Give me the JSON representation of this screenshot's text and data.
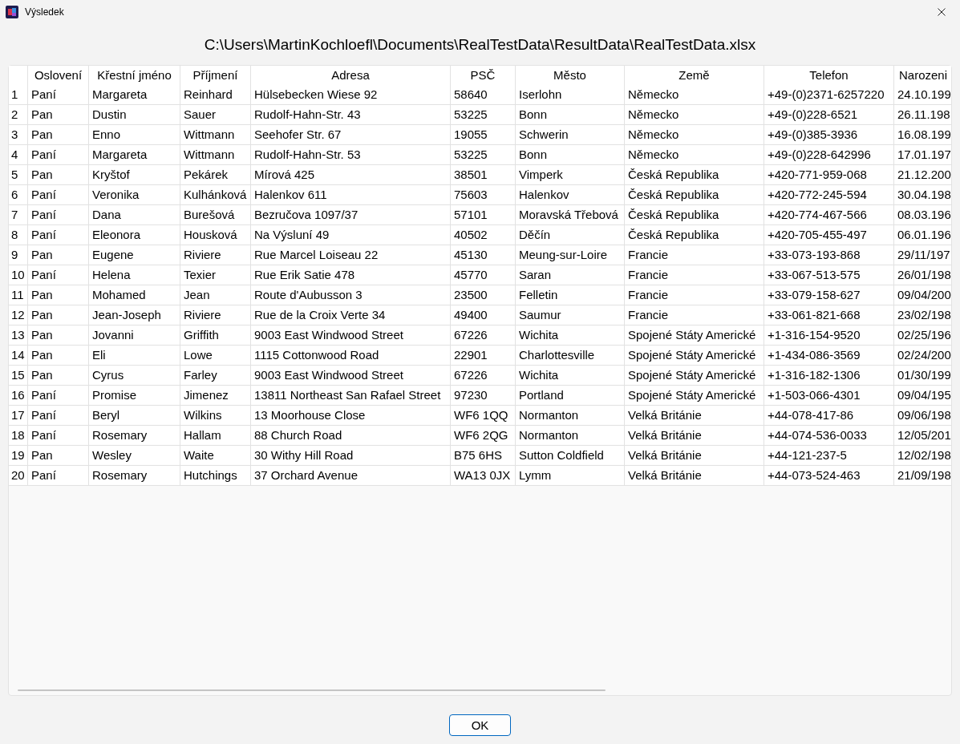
{
  "window": {
    "title": "Výsledek"
  },
  "path": "C:\\Users\\MartinKochloefl\\Documents\\RealTestData\\ResultData\\RealTestData.xlsx",
  "table": {
    "columns": [
      "Oslovení",
      "Křestní jméno",
      "Příjmení",
      "Adresa",
      "PSČ",
      "Město",
      "Země",
      "Telefon",
      "Narozeni"
    ],
    "rows": [
      {
        "number": "1",
        "cells": [
          "Paní",
          "Margareta",
          "Reinhard",
          "Hülsebecken Wiese 92",
          "58640",
          "Iserlohn",
          "Německo",
          "+49-(0)2371-6257220",
          "24.10.199"
        ]
      },
      {
        "number": "2",
        "cells": [
          "Pan",
          "Dustin",
          "Sauer",
          "Rudolf-Hahn-Str. 43",
          "53225",
          "Bonn",
          "Německo",
          "+49-(0)228-6521",
          "26.11.198"
        ]
      },
      {
        "number": "3",
        "cells": [
          "Pan",
          "Enno",
          "Wittmann",
          "Seehofer Str. 67",
          "19055",
          "Schwerin",
          "Německo",
          "+49-(0)385-3936",
          "16.08.199"
        ]
      },
      {
        "number": "4",
        "cells": [
          "Paní",
          "Margareta",
          "Wittmann",
          "Rudolf-Hahn-Str. 53",
          "53225",
          "Bonn",
          "Německo",
          "+49-(0)228-642996",
          "17.01.197"
        ]
      },
      {
        "number": "5",
        "cells": [
          "Pan",
          "Kryštof",
          "Pekárek",
          "Mírová 425",
          "38501",
          "Vimperk",
          "Česká Republika",
          "+420-771-959-068",
          "21.12.200"
        ]
      },
      {
        "number": "6",
        "cells": [
          "Paní",
          "Veronika",
          "Kulhánková",
          "Halenkov 611",
          "75603",
          "Halenkov",
          "Česká Republika",
          "+420-772-245-594",
          "30.04.198"
        ]
      },
      {
        "number": "7",
        "cells": [
          "Paní",
          "Dana",
          "Burešová",
          "Bezručova 1097/37",
          "57101",
          "Moravská Třebová",
          "Česká Republika",
          "+420-774-467-566",
          "08.03.196"
        ]
      },
      {
        "number": "8",
        "cells": [
          "Paní",
          "Eleonora",
          "Housková",
          "Na Výsluní 49",
          "40502",
          "Děčín",
          "Česká Republika",
          "+420-705-455-497",
          "06.01.196"
        ]
      },
      {
        "number": "9",
        "cells": [
          "Pan",
          "Eugene",
          "Riviere",
          "Rue Marcel Loiseau 22",
          "45130",
          "Meung-sur-Loire",
          "Francie",
          "+33-073-193-868",
          "29/11/197"
        ]
      },
      {
        "number": "10",
        "cells": [
          "Paní",
          "Helena",
          "Texier",
          "Rue Erik Satie 478",
          "45770",
          "Saran",
          "Francie",
          "+33-067-513-575",
          "26/01/198"
        ]
      },
      {
        "number": "11",
        "cells": [
          "Pan",
          "Mohamed",
          "Jean",
          "Route d'Aubusson 3",
          "23500",
          "Felletin",
          "Francie",
          "+33-079-158-627",
          "09/04/200"
        ]
      },
      {
        "number": "12",
        "cells": [
          "Pan",
          "Jean-Joseph",
          "Riviere",
          "Rue de la Croix Verte 34",
          "49400",
          "Saumur",
          "Francie",
          "+33-061-821-668",
          "23/02/198"
        ]
      },
      {
        "number": "13",
        "cells": [
          "Pan",
          "Jovanni",
          "Griffith",
          "9003 East Windwood Street",
          "67226",
          "Wichita",
          "Spojené Státy Americké",
          "+1-316-154-9520",
          "02/25/196"
        ]
      },
      {
        "number": "14",
        "cells": [
          "Pan",
          "Eli",
          "Lowe",
          "1115 Cottonwood Road",
          "22901",
          "Charlottesville",
          "Spojené Státy Americké",
          "+1-434-086-3569",
          "02/24/200"
        ]
      },
      {
        "number": "15",
        "cells": [
          "Pan",
          "Cyrus",
          "Farley",
          "9003 East Windwood Street",
          "67226",
          "Wichita",
          "Spojené Státy Americké",
          "+1-316-182-1306",
          "01/30/199"
        ]
      },
      {
        "number": "16",
        "cells": [
          "Paní",
          "Promise",
          "Jimenez",
          "13811 Northeast San Rafael Street",
          "97230",
          "Portland",
          "Spojené Státy Americké",
          "+1-503-066-4301",
          "09/04/195"
        ]
      },
      {
        "number": "17",
        "cells": [
          "Paní",
          "Beryl",
          "Wilkins",
          "13 Moorhouse Close",
          "WF6 1QQ",
          "Normanton",
          "Velká Británie",
          "+44-078-417-86",
          "09/06/198"
        ]
      },
      {
        "number": "18",
        "cells": [
          "Paní",
          "Rosemary",
          "Hallam",
          "88 Church Road",
          "WF6 2QG",
          "Normanton",
          "Velká Británie",
          "+44-074-536-0033",
          "12/05/201"
        ]
      },
      {
        "number": "19",
        "cells": [
          "Pan",
          "Wesley",
          "Waite",
          "30 Withy Hill Road",
          "B75 6HS",
          "Sutton Coldfield",
          "Velká Británie",
          "+44-121-237-5",
          "12/02/198"
        ]
      },
      {
        "number": "20",
        "cells": [
          "Paní",
          "Rosemary",
          "Hutchings",
          "37 Orchard Avenue",
          "WA13 0JX",
          "Lymm",
          "Velká Británie",
          "+44-073-524-463",
          "21/09/198"
        ]
      }
    ]
  },
  "buttons": [
    "OK"
  ]
}
